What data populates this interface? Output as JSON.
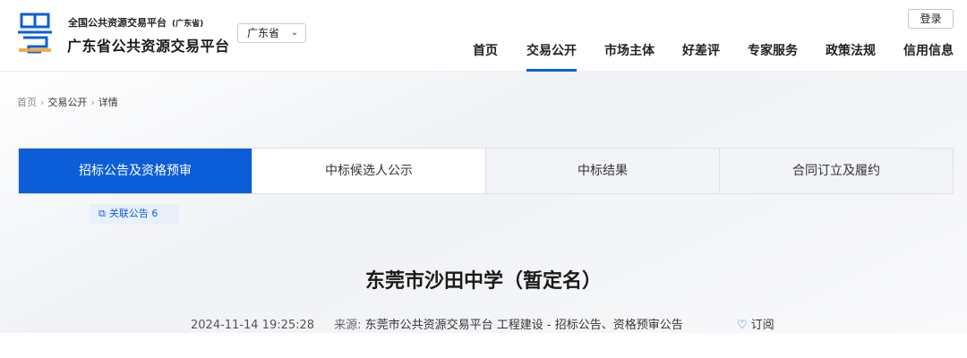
{
  "header": {
    "platform_sub": "全国公共资源交易平台",
    "platform_sub_province": "(广东省)",
    "platform_main": "广东省公共资源交易平台",
    "region": "广东省",
    "login_label": "登录",
    "logo_icon": "cantonese-character-logo-icon",
    "accent_color": "#0b5ed7"
  },
  "nav": {
    "items": [
      {
        "label": "首页"
      },
      {
        "label": "交易公开"
      },
      {
        "label": "市场主体"
      },
      {
        "label": "好差评"
      },
      {
        "label": "专家服务"
      },
      {
        "label": "政策法规"
      },
      {
        "label": "信用信息"
      }
    ],
    "active": "交易公开"
  },
  "breadcrumb": {
    "items": [
      "首页",
      "交易公开",
      "详情"
    ]
  },
  "tabs": {
    "items": [
      {
        "label": "招标公告及资格预审"
      },
      {
        "label": "中标候选人公示"
      },
      {
        "label": "中标结果"
      },
      {
        "label": "合同订立及履约"
      }
    ],
    "active": "招标公告及资格预审"
  },
  "related": {
    "label": "关联公告",
    "count": "6",
    "icon": "copy-icon"
  },
  "article": {
    "title": "东莞市沙田中学（暂定名）",
    "datetime": "2024-11-14 19:25:28",
    "source_label": "来源:",
    "source": "东莞市公共资源交易平台 工程建设 - 招标公告、资格预审公告",
    "subscribe_label": "订阅",
    "subscribe_icon": "heart-outline-icon"
  }
}
